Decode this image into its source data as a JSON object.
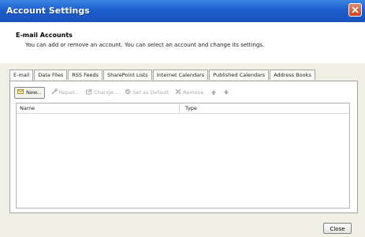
{
  "window": {
    "title": "Account Settings"
  },
  "header": {
    "title": "E-mail Accounts",
    "subtitle": "You can add or remove an account. You can select an account and change its settings."
  },
  "tabs": [
    {
      "label": "E-mail",
      "active": true
    },
    {
      "label": "Data Files"
    },
    {
      "label": "RSS Feeds"
    },
    {
      "label": "SharePoint Lists"
    },
    {
      "label": "Internet Calendars"
    },
    {
      "label": "Published Calendars"
    },
    {
      "label": "Address Books"
    }
  ],
  "toolbar": {
    "new_label": "New...",
    "repair_label": "Repair...",
    "change_label": "Change...",
    "default_label": "Set as Default",
    "remove_label": "Remove"
  },
  "list": {
    "columns": [
      "Name",
      "Type"
    ]
  },
  "footer": {
    "close_label": "Close"
  },
  "colors": {
    "titlebar": "#1d5fcf",
    "dialog_bg": "#f0efe6"
  }
}
